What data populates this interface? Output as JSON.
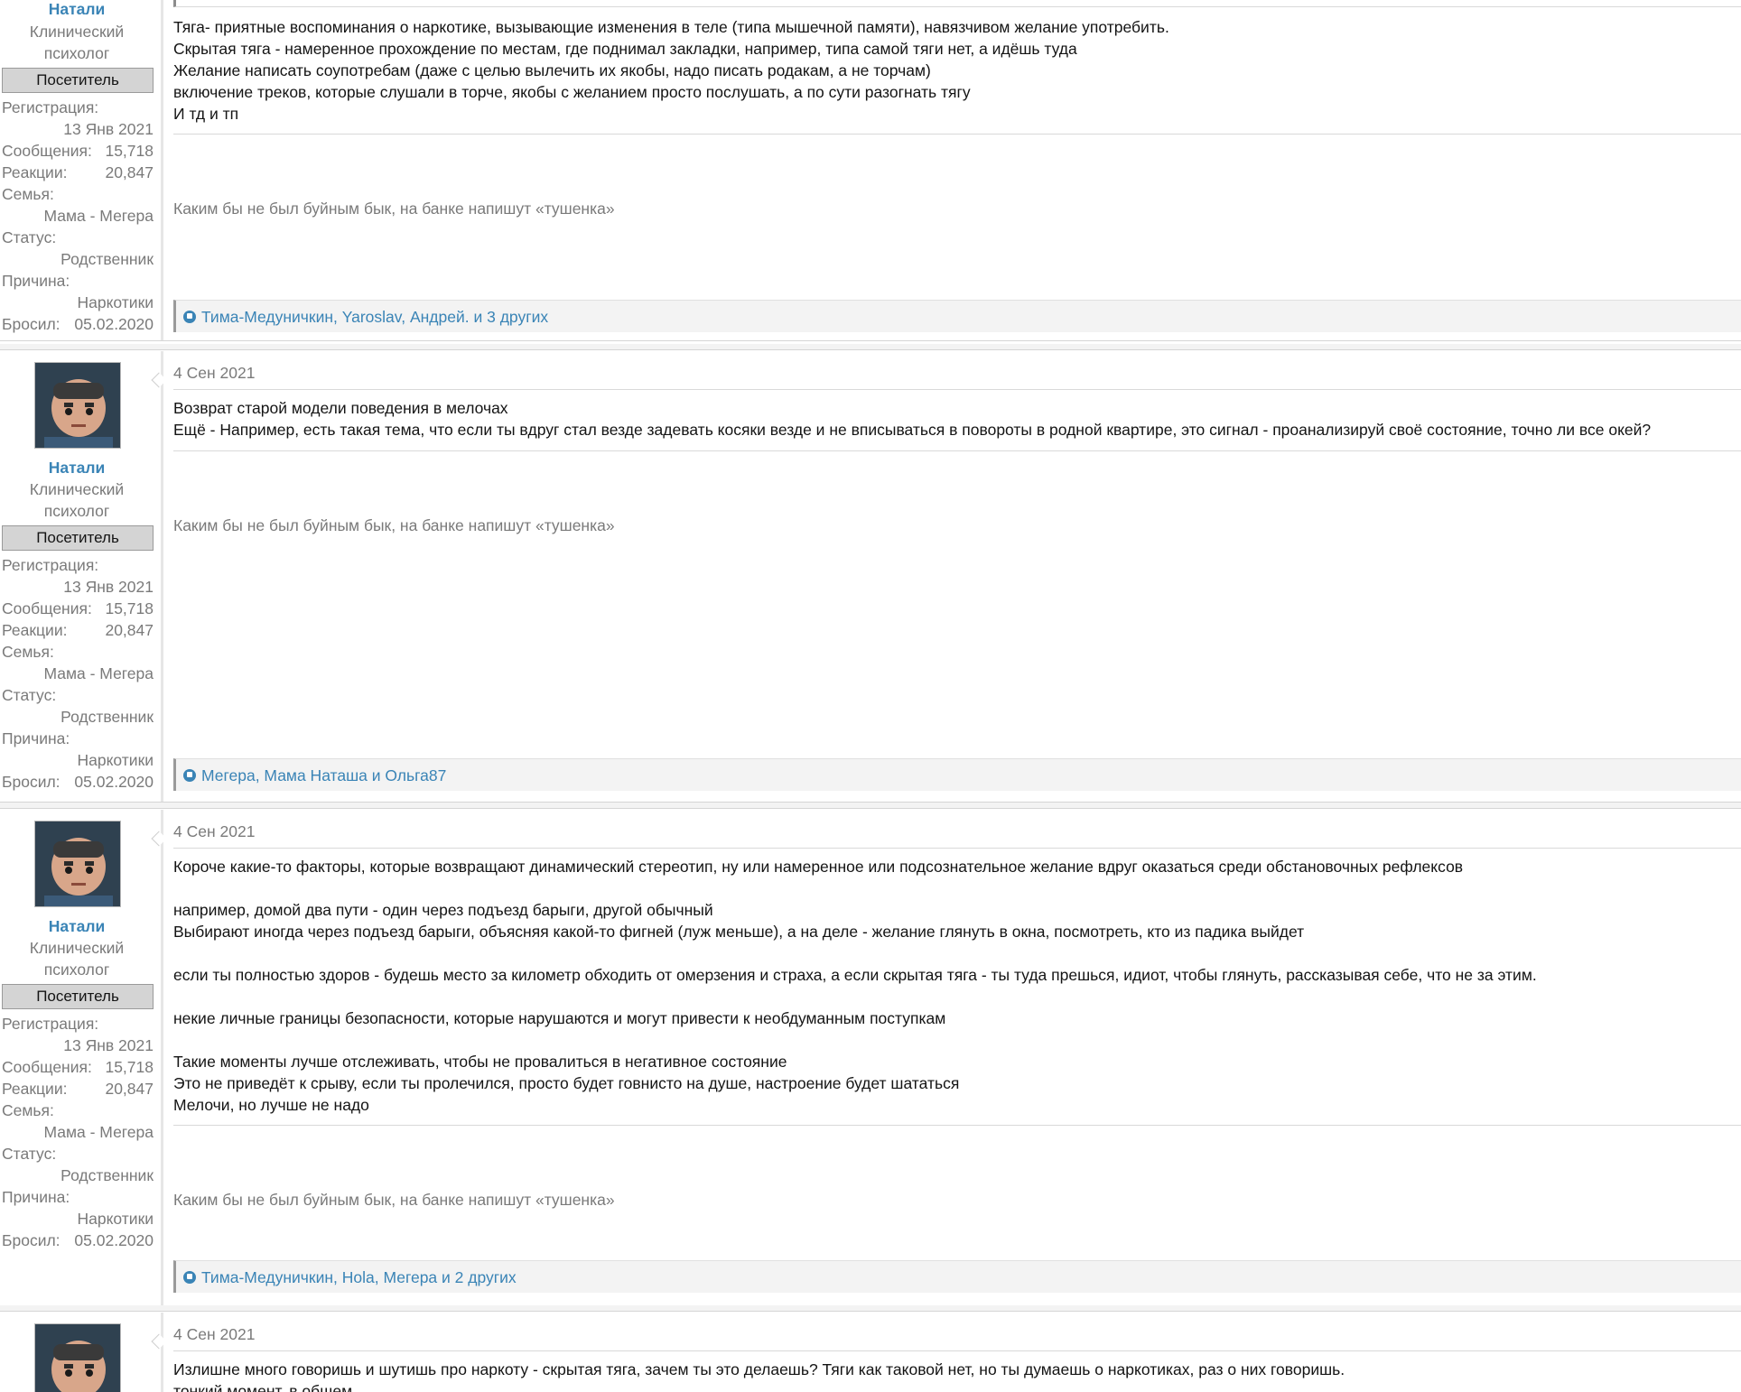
{
  "user": {
    "name": "Натали",
    "title": "Клинический психолог",
    "badge": "Посетитель",
    "reg_label": "Регистрация:",
    "reg_value": "13 Янв 2021",
    "msgs_label": "Сообщения:",
    "msgs_value": "15,718",
    "react_label": "Реакции:",
    "react_value": "20,847",
    "family_label": "Семья:",
    "family_value": "Мама - Мегера",
    "status_label": "Статус:",
    "status_value": "Родственник",
    "reason_label": "Причина:",
    "reason_value": "Наркотики",
    "quit_label": "Бросил:",
    "quit_value": "05.02.2020"
  },
  "signature": "Каким бы не был буйным бык, на банке напишут «тушенка»",
  "posts": [
    {
      "date": "",
      "body": "Тяга- приятные воспоминания о наркотике, вызывающие изменения в теле (типа мышечной памяти), навязчивом желание употребить.\nСкрытая тяга - намеренное прохождение по местам, где поднимал закладки, например, типа самой тяги нет, а идёшь туда\nЖелание написать соупотребам (даже с целью вылечить их якобы, надо писать родакам, а не торчам)\nвключение треков, которые слушали в торче, якобы с желанием просто послушать, а по сути разогнать тягу\nИ тд и тп",
      "likes": "Тима-Медуничкин, Yaroslav, Андрей. и 3 других"
    },
    {
      "date": "4 Сен 2021",
      "body": "Возврат старой модели поведения в мелочах\nЕщё - Например, есть такая тема, что если ты вдруг стал везде задевать косяки везде и не вписываться в повороты в родной квартире, это сигнал - проанализируй своё состояние, точно ли все окей?",
      "likes": "Мегера, Мама Наташа и Ольга87"
    },
    {
      "date": "4 Сен 2021",
      "body": "Короче какие-то факторы, которые возвращают динамический стереотип, ну или намеренное или подсознательное желание вдруг оказаться среди обстановочных рефлексов\n\nнапример, домой два пути - один через подъезд барыги, другой обычный\nВыбирают иногда через подъезд барыги, объясняя какой-то фигней (луж меньше), а на деле - желание глянуть в окна, посмотреть, кто из падика выйдет\n\nесли ты полностью здоров - будешь место за километр обходить от омерзения и страха, а если скрытая тяга - ты туда прешься, идиот, чтобы глянуть, рассказывая себе, что не за этим.\n\nнекие личные границы безопасности, которые нарушаются и могут привести к необдуманным поступкам\n\nТакие моменты лучше отслеживать, чтобы не провалиться в негативное состояние\nЭто не приведёт к срыву, если ты пролечился, просто будет говнисто на душе, настроение будет шататься\nМелочи, но лучше не надо",
      "likes": "Тима-Медуничкин, Hola, Мегера и 2 других"
    },
    {
      "date": "4 Сен 2021",
      "body": "Излишне много говоришь и шутишь про наркоту - скрытая тяга, зачем ты это делаешь? Тяги как таковой нет, но ты думаешь о наркотиках, раз о них говоришь.\nтонкий момент, в общем",
      "likes": ""
    }
  ]
}
